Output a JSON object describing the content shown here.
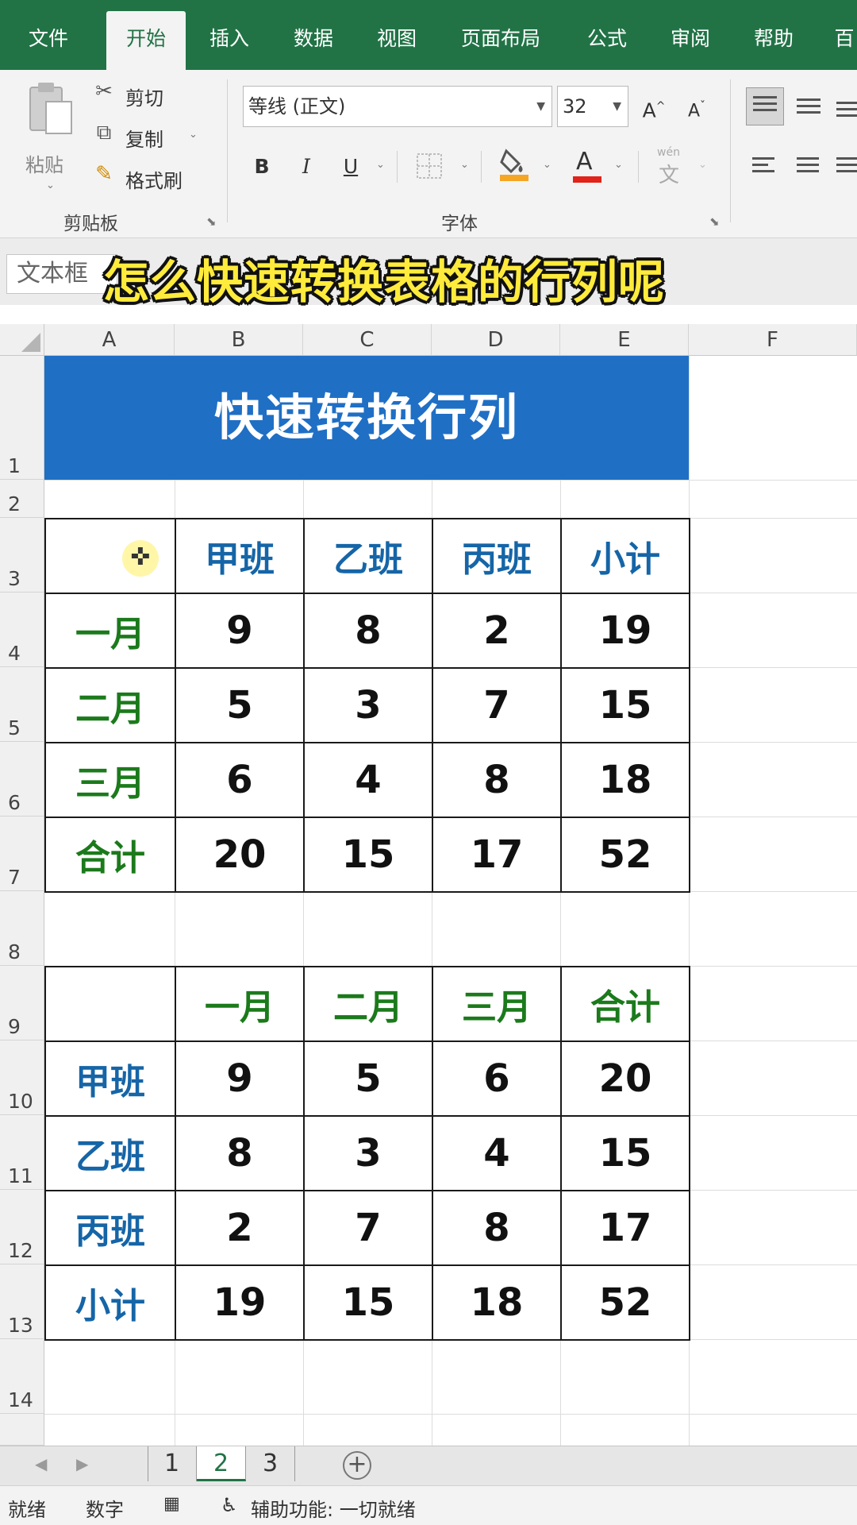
{
  "ribbon_tabs": [
    "文件",
    "开始",
    "插入",
    "数据",
    "视图",
    "页面布局",
    "公式",
    "审阅",
    "帮助",
    "百"
  ],
  "clipboard": {
    "paste": "粘贴",
    "cut": "剪切",
    "copy": "复制",
    "format_painter": "格式刷",
    "group_label": "剪贴板"
  },
  "font": {
    "name": "等线 (正文)",
    "size": "32",
    "bold": "B",
    "italic": "I",
    "underline": "U",
    "font_color_glyph": "A",
    "grow_glyph": "A",
    "shrink_glyph": "A",
    "pinyin_glyph": "文",
    "pinyin_top": "wén",
    "group_label": "字体"
  },
  "formula_bar": {
    "name_box": "文本框"
  },
  "caption": "怎么快速转换表格的行列呢",
  "columns": [
    "A",
    "B",
    "C",
    "D",
    "E",
    "F"
  ],
  "row_numbers": [
    "1",
    "2",
    "3",
    "4",
    "5",
    "6",
    "7",
    "8",
    "9",
    "10",
    "11",
    "12",
    "13",
    "14"
  ],
  "sheet": {
    "title": "快速转换行列",
    "table1": {
      "headers": [
        "",
        "甲班",
        "乙班",
        "丙班",
        "小计"
      ],
      "rows": [
        [
          "一月",
          "9",
          "8",
          "2",
          "19"
        ],
        [
          "二月",
          "5",
          "3",
          "7",
          "15"
        ],
        [
          "三月",
          "6",
          "4",
          "8",
          "18"
        ],
        [
          "合计",
          "20",
          "15",
          "17",
          "52"
        ]
      ]
    },
    "table2": {
      "headers": [
        "",
        "一月",
        "二月",
        "三月",
        "合计"
      ],
      "rows": [
        [
          "甲班",
          "9",
          "5",
          "6",
          "20"
        ],
        [
          "乙班",
          "8",
          "3",
          "4",
          "15"
        ],
        [
          "丙班",
          "2",
          "7",
          "8",
          "17"
        ],
        [
          "小计",
          "19",
          "15",
          "18",
          "52"
        ]
      ]
    }
  },
  "sheet_tabs": [
    "1",
    "2",
    "3"
  ],
  "status": {
    "ready": "就绪",
    "mode": "数字",
    "accessibility": "辅助功能: 一切就绪"
  },
  "colors": {
    "excel_green": "#217346",
    "title_blue": "#1f6fc5",
    "header_blue_text": "#1565a7",
    "header_green_text": "#1b7a1b",
    "caption_yellow": "#ffeb3b"
  }
}
